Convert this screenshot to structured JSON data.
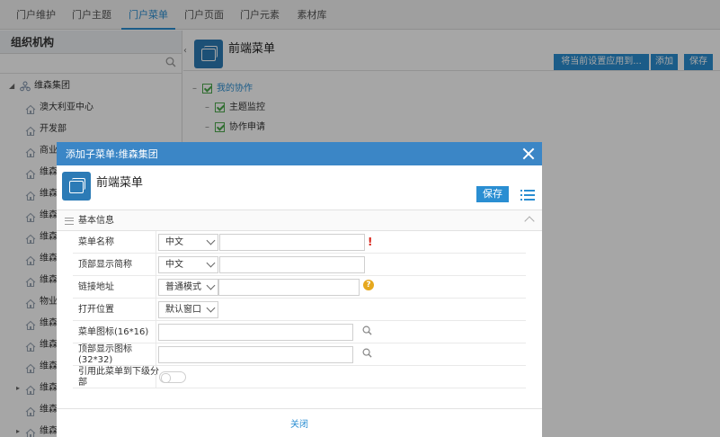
{
  "top_tabs": [
    "门户维护",
    "门户主题",
    "门户菜单",
    "门户页面",
    "门户元素",
    "素材库"
  ],
  "active_tab": 2,
  "sidebar": {
    "title": "组织机构",
    "root": "维森集团",
    "items": [
      "澳大利亚中心",
      "开发部",
      "商业",
      "维森",
      "维森",
      "维森",
      "维森",
      "维森",
      "维森",
      "物业",
      "维森",
      "维森",
      "维森",
      "维森",
      "维森",
      "维森"
    ]
  },
  "main": {
    "title": "前端菜单",
    "apply_button": "将当前设置应用到...",
    "add_button": "添加",
    "save_button": "保存",
    "tree": {
      "root": "我的协作",
      "children": [
        "主题监控",
        "协作申请"
      ]
    }
  },
  "modal": {
    "header": "添加子菜单:维森集团",
    "title": "前端菜单",
    "save_button": "保存",
    "section_label": "基本信息",
    "fields": {
      "menu_name": {
        "label": "菜单名称",
        "lang": "中文",
        "value": ""
      },
      "top_short_name": {
        "label": "顶部显示简称",
        "lang": "中文",
        "value": ""
      },
      "link": {
        "label": "链接地址",
        "mode": "普通模式",
        "value": ""
      },
      "open_position": {
        "label": "打开位置",
        "value": "默认窗口"
      },
      "menu_icon": {
        "label": "菜单图标(16*16)",
        "value": ""
      },
      "top_icon": {
        "label": "顶部显示图标(32*32)",
        "value": ""
      },
      "cite": {
        "label": "引用此菜单到下级分部",
        "on": false
      }
    },
    "close_label": "关闭"
  },
  "colors": {
    "accent": "#2a8ed2",
    "modal_header": "#3b86c6",
    "required": "#d9261c",
    "help": "#e6a81e",
    "check": "#4caa4c"
  }
}
